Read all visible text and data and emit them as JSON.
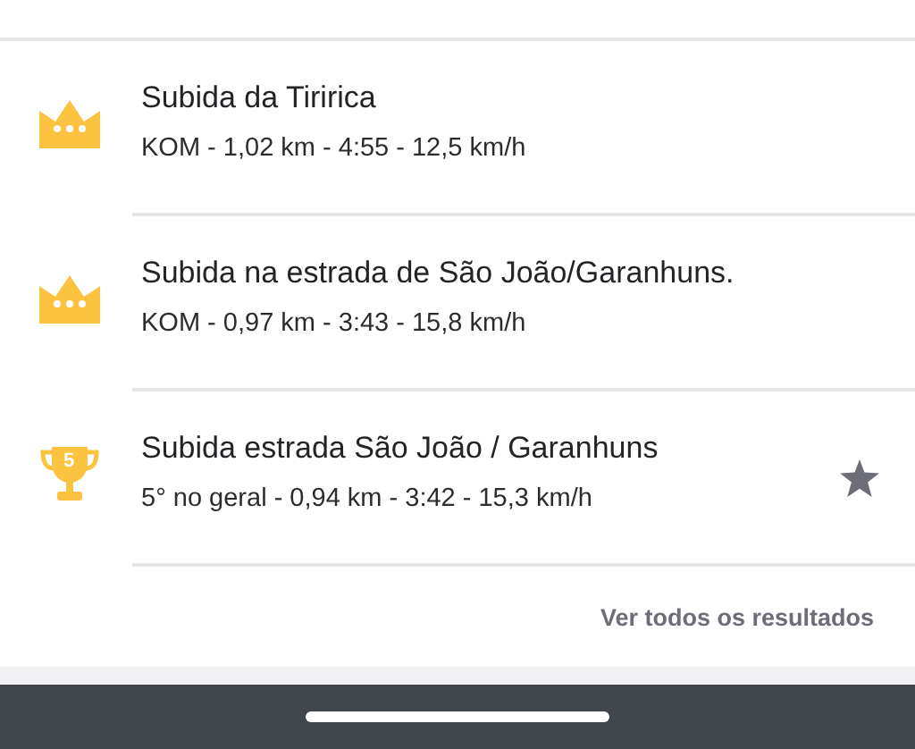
{
  "segments": [
    {
      "kind": "crown",
      "name": "Subida da Tiririca",
      "details": "KOM - 1,02 km - 4:55 - 12,5 km/h",
      "starred": false
    },
    {
      "kind": "crown",
      "name": "Subida na estrada de São João/Garanhuns.",
      "details": "KOM - 0,97 km - 3:43 - 15,8 km/h",
      "starred": false
    },
    {
      "kind": "trophy",
      "rank": "5",
      "name": "Subida estrada São João / Garanhuns",
      "details": "5° no geral - 0,94 km - 3:42 - 15,3 km/h",
      "starred": true
    }
  ],
  "see_all_link": "Ver todos os resultados"
}
